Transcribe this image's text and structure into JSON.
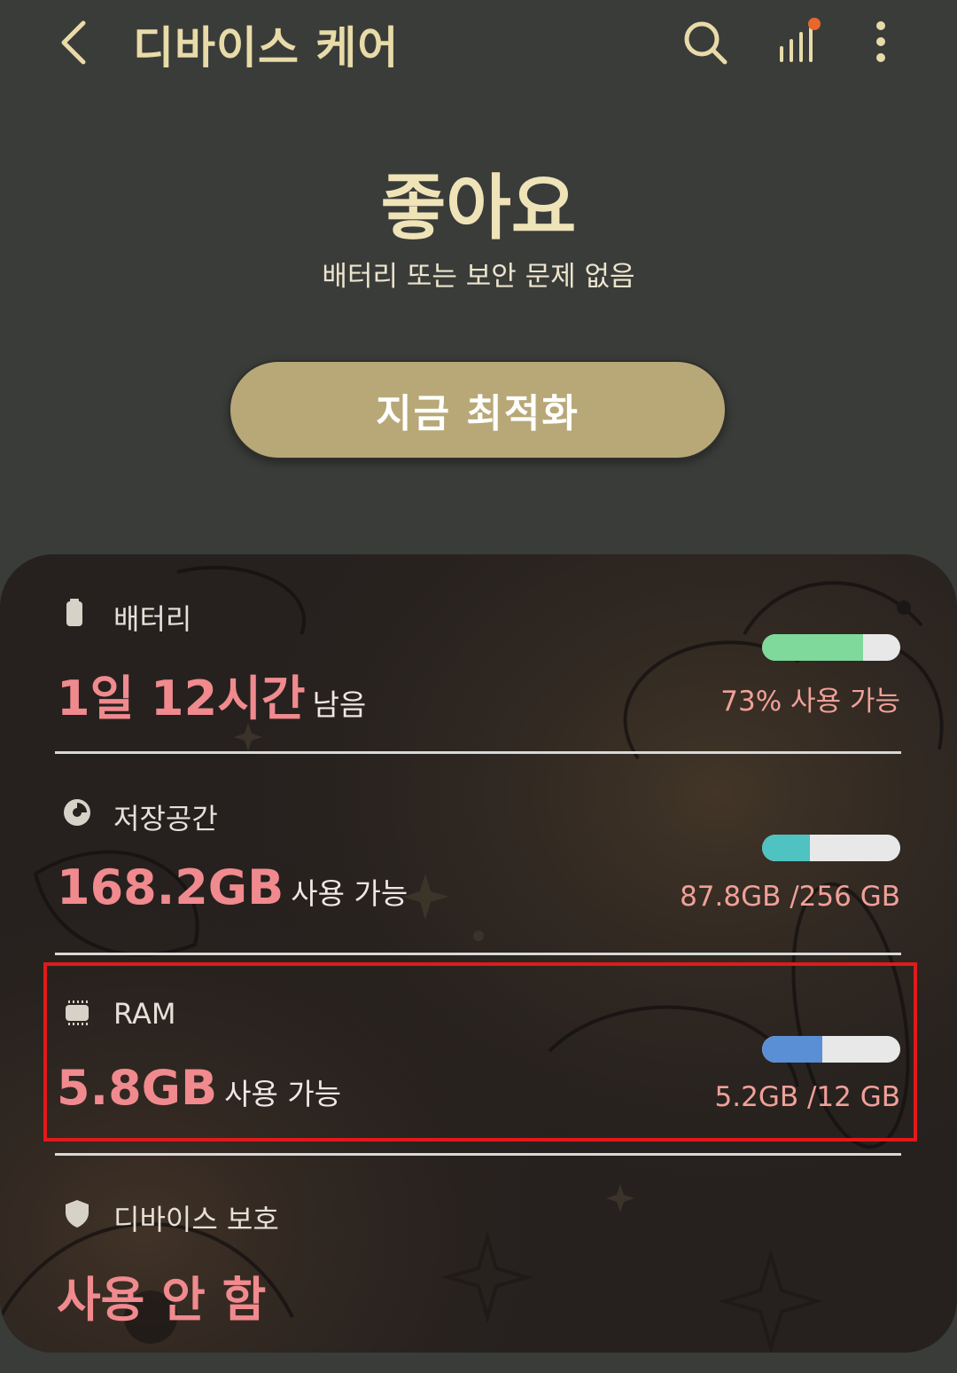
{
  "header": {
    "title": "디바이스 케어",
    "icons": [
      "back-icon",
      "search-icon",
      "stats-icon",
      "more-options-icon"
    ],
    "notification_dot_color": "#e8672a"
  },
  "status": {
    "main": "좋아요",
    "sub": "배터리 또는 보안 문제 없음",
    "button_label": "지금 최적화"
  },
  "items": {
    "battery": {
      "label": "배터리",
      "value": "1일 12시간",
      "suffix": "남음",
      "right": "73% 사용 가능",
      "fill": 0.73,
      "color": "#7ed99a"
    },
    "storage": {
      "label": "저장공간",
      "value": "168.2GB",
      "suffix": "사용 가능",
      "right": "87.8GB /256 GB",
      "fill": 0.343,
      "color": "#4fc2c2"
    },
    "ram": {
      "label": "RAM",
      "value": "5.8GB",
      "suffix": "사용 가능",
      "right": "5.2GB /12 GB",
      "fill": 0.433,
      "color": "#5a8fd6"
    },
    "protection": {
      "label": "디바이스 보호",
      "value": "사용 안 함"
    }
  }
}
